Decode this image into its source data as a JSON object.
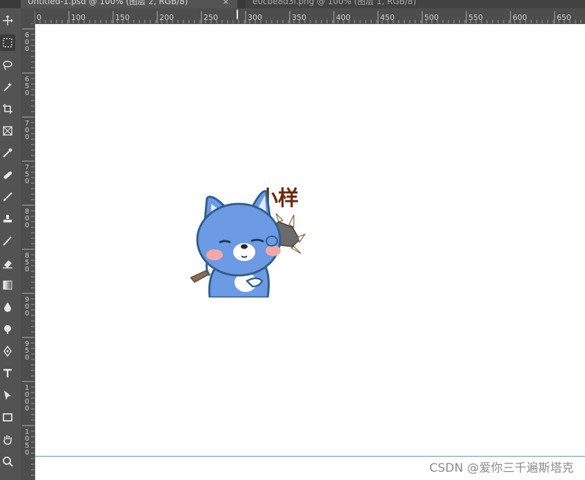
{
  "tabs": [
    {
      "label": "Untitled-1.psd @ 100% (图层 2, RGB/8)",
      "active": true
    },
    {
      "label": "e0cbe8d3f.png @ 100% (图层 1, RGB/8)",
      "active": false
    }
  ],
  "ruler": {
    "horizontal_labels": [
      "0",
      "100",
      "150",
      "200",
      "250",
      "300",
      "350",
      "400",
      "450",
      "500",
      "550",
      "600",
      "650"
    ],
    "vertical_labels": [
      "600",
      "650",
      "700",
      "750",
      "800",
      "850",
      "900",
      "950",
      "1000",
      "1050"
    ]
  },
  "tools": [
    {
      "name": "move-tool-icon",
      "selected": false
    },
    {
      "name": "rectangular-marquee-tool-icon",
      "selected": true
    },
    {
      "name": "lasso-tool-icon",
      "selected": false
    },
    {
      "name": "quick-selection-tool-icon",
      "selected": false
    },
    {
      "name": "crop-tool-icon",
      "selected": false
    },
    {
      "name": "frame-tool-icon",
      "selected": false
    },
    {
      "name": "eyedropper-tool-icon",
      "selected": false
    },
    {
      "name": "healing-brush-tool-icon",
      "selected": false
    },
    {
      "name": "brush-tool-icon",
      "selected": false
    },
    {
      "name": "clone-stamp-tool-icon",
      "selected": false
    },
    {
      "name": "history-brush-tool-icon",
      "selected": false
    },
    {
      "name": "eraser-tool-icon",
      "selected": false
    },
    {
      "name": "gradient-tool-icon",
      "selected": false
    },
    {
      "name": "blur-tool-icon",
      "selected": false
    },
    {
      "name": "dodge-tool-icon",
      "selected": false
    },
    {
      "name": "pen-tool-icon",
      "selected": false
    },
    {
      "name": "type-tool-icon",
      "selected": false
    },
    {
      "name": "path-selection-tool-icon",
      "selected": false
    },
    {
      "name": "rectangle-tool-icon",
      "selected": false
    },
    {
      "name": "hand-tool-icon",
      "selected": false
    },
    {
      "name": "zoom-tool-icon",
      "selected": false
    }
  ],
  "canvas": {
    "sticker_text": "小样",
    "background": "#ffffff",
    "guide_color": "#6a94b0"
  },
  "watermark": "CSDN @爱你三千遍斯塔克"
}
